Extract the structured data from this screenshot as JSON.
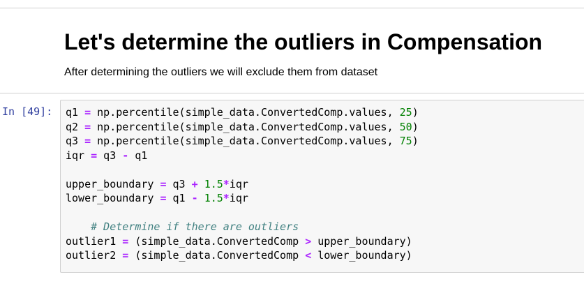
{
  "markdown": {
    "heading": "Let's determine the outliers in Compensation",
    "text": "After determining the outliers we will exclude them from dataset"
  },
  "code_cell": {
    "prompt": "In [49]:",
    "lines": [
      [
        {
          "t": "q1 "
        },
        {
          "t": "=",
          "k": "op"
        },
        {
          "t": " np.percentile(simple_data.ConvertedComp.values, "
        },
        {
          "t": "25",
          "k": "num"
        },
        {
          "t": ")"
        }
      ],
      [
        {
          "t": "q2 "
        },
        {
          "t": "=",
          "k": "op"
        },
        {
          "t": " np.percentile(simple_data.ConvertedComp.values, "
        },
        {
          "t": "50",
          "k": "num"
        },
        {
          "t": ")"
        }
      ],
      [
        {
          "t": "q3 "
        },
        {
          "t": "=",
          "k": "op"
        },
        {
          "t": " np.percentile(simple_data.ConvertedComp.values, "
        },
        {
          "t": "75",
          "k": "num"
        },
        {
          "t": ")"
        }
      ],
      [
        {
          "t": "iqr "
        },
        {
          "t": "=",
          "k": "op"
        },
        {
          "t": " q3 "
        },
        {
          "t": "-",
          "k": "op"
        },
        {
          "t": " q1"
        }
      ],
      [],
      [
        {
          "t": "upper_boundary "
        },
        {
          "t": "=",
          "k": "op"
        },
        {
          "t": " q3 "
        },
        {
          "t": "+",
          "k": "op"
        },
        {
          "t": " "
        },
        {
          "t": "1.5",
          "k": "num"
        },
        {
          "t": "*",
          "k": "op"
        },
        {
          "t": "iqr"
        }
      ],
      [
        {
          "t": "lower_boundary "
        },
        {
          "t": "=",
          "k": "op"
        },
        {
          "t": " q1 "
        },
        {
          "t": "-",
          "k": "op"
        },
        {
          "t": " "
        },
        {
          "t": "1.5",
          "k": "num"
        },
        {
          "t": "*",
          "k": "op"
        },
        {
          "t": "iqr"
        }
      ],
      [],
      [
        {
          "t": "    "
        },
        {
          "t": "# Determine if there are outliers",
          "k": "cm"
        }
      ],
      [
        {
          "t": "outlier1 "
        },
        {
          "t": "=",
          "k": "op"
        },
        {
          "t": " (simple_data.ConvertedComp "
        },
        {
          "t": ">",
          "k": "op"
        },
        {
          "t": " upper_boundary)"
        }
      ],
      [
        {
          "t": "outlier2 "
        },
        {
          "t": "=",
          "k": "op"
        },
        {
          "t": " (simple_data.ConvertedComp "
        },
        {
          "t": "<",
          "k": "op"
        },
        {
          "t": " lower_boundary)"
        }
      ]
    ]
  },
  "colors": {
    "prompt": "#303f9f",
    "operator": "#aa22ff",
    "number": "#008000",
    "comment": "#408080",
    "cell_background": "#f7f7f7",
    "cell_border": "#cfcfcf"
  }
}
